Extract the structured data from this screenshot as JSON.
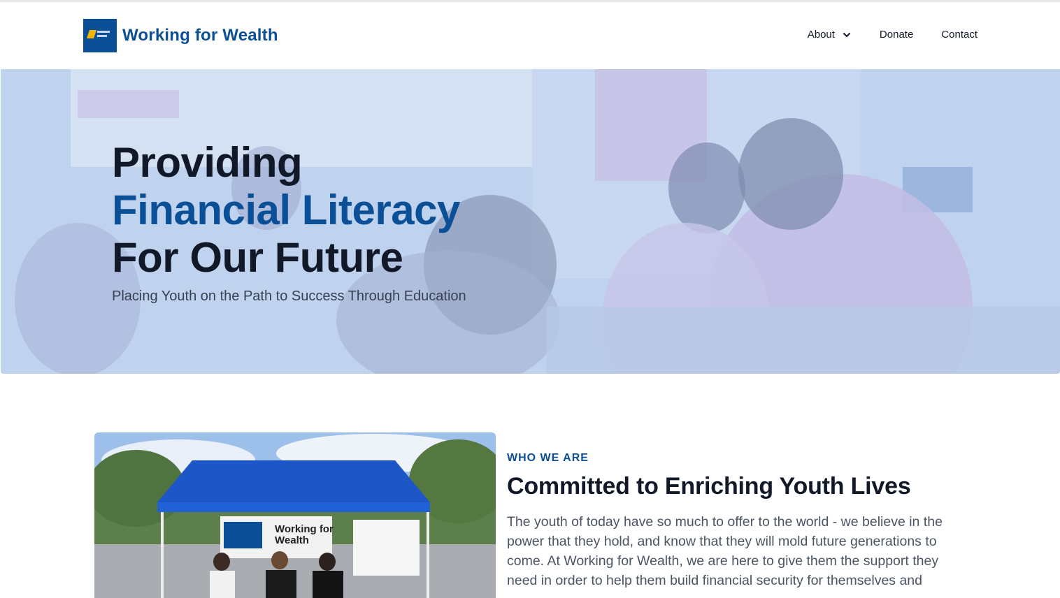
{
  "header": {
    "brand_name": "Working for Wealth",
    "nav": [
      {
        "label": "About",
        "has_dropdown": true
      },
      {
        "label": "Donate",
        "has_dropdown": false
      },
      {
        "label": "Contact",
        "has_dropdown": false
      }
    ]
  },
  "hero": {
    "line1": "Providing",
    "line2": "Financial Literacy",
    "line3": "For Our Future",
    "subtitle": "Placing Youth on the Path to Success Through Education"
  },
  "about": {
    "eyebrow": "WHO WE ARE",
    "title": "Committed to Enriching Youth Lives",
    "body": "The youth of today have so much to offer to the world - we believe in the power that they hold, and know that they will mold future generations to come. At Working for Wealth, we are here to give them the support they need in order to help them build financial security for themselves and",
    "photo_banner": "Working for Wealth"
  },
  "colors": {
    "brand_blue": "#0b4f96",
    "heading_dark": "#111827",
    "body_gray": "#4b5563"
  }
}
